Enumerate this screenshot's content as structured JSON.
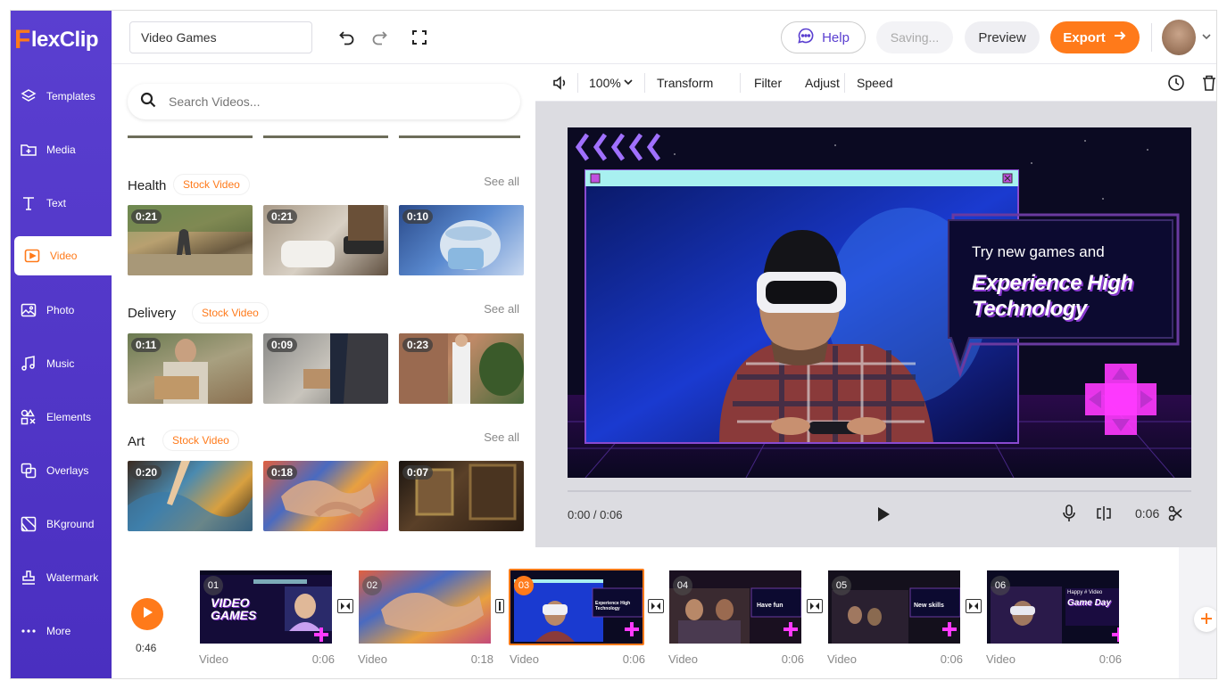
{
  "app": {
    "logo_mark": "F",
    "logo_rest": "lexClip",
    "project_title": "Video Games",
    "colors": {
      "brand": "#5a3fd0",
      "accent": "#ff7a1a"
    }
  },
  "sidebar": {
    "items": [
      {
        "label": "Templates",
        "icon": "layers-icon"
      },
      {
        "label": "Media",
        "icon": "folder-plus-icon"
      },
      {
        "label": "Text",
        "icon": "text-icon"
      },
      {
        "label": "Video",
        "icon": "video-play-icon",
        "active": true
      },
      {
        "label": "Photo",
        "icon": "image-icon"
      },
      {
        "label": "Music",
        "icon": "music-note-icon"
      },
      {
        "label": "Elements",
        "icon": "shapes-icon"
      },
      {
        "label": "Overlays",
        "icon": "overlay-icon"
      },
      {
        "label": "BKground",
        "icon": "background-icon"
      },
      {
        "label": "Watermark",
        "icon": "stamp-icon"
      },
      {
        "label": "More",
        "icon": "more-dots-icon"
      }
    ]
  },
  "topbar": {
    "help_label": "Help",
    "saving_label": "Saving...",
    "preview_label": "Preview",
    "export_label": "Export"
  },
  "library": {
    "search_placeholder": "Search Videos...",
    "see_all": "See all",
    "sections": [
      {
        "title": "Health",
        "tag": "Stock Video",
        "durations": [
          "0:21",
          "0:21",
          "0:10"
        ]
      },
      {
        "title": "Delivery",
        "tag": "Stock Video",
        "durations": [
          "0:11",
          "0:09",
          "0:23"
        ]
      },
      {
        "title": "Art",
        "tag": "Stock Video",
        "durations": [
          "0:20",
          "0:18",
          "0:07"
        ]
      }
    ]
  },
  "toolbar": {
    "zoom": "100%",
    "transform": "Transform",
    "filter": "Filter",
    "adjust": "Adjust",
    "speed": "Speed"
  },
  "canvas": {
    "headline_small": "Try new games and",
    "headline_big_1": "Experience High",
    "headline_big_2": "Technology"
  },
  "player": {
    "time_position": "0:00 / 0:06",
    "clip_duration": "0:06"
  },
  "timeline": {
    "total_duration": "0:46",
    "clips": [
      {
        "num": "01",
        "label": "Video",
        "duration": "0:06",
        "text_1": "VIDEO",
        "text_2": "GAMES"
      },
      {
        "num": "02",
        "label": "Video",
        "duration": "0:18"
      },
      {
        "num": "03",
        "label": "Video",
        "duration": "0:06",
        "active": true,
        "text_1": "Experience High",
        "text_2": "Technology"
      },
      {
        "num": "04",
        "label": "Video",
        "duration": "0:06",
        "text_1": "Have fun"
      },
      {
        "num": "05",
        "label": "Video",
        "duration": "0:06",
        "text_1": "New skills"
      },
      {
        "num": "06",
        "label": "Video",
        "duration": "0:06",
        "text_1": "Happy # Video",
        "text_2": "Game Day"
      }
    ]
  }
}
